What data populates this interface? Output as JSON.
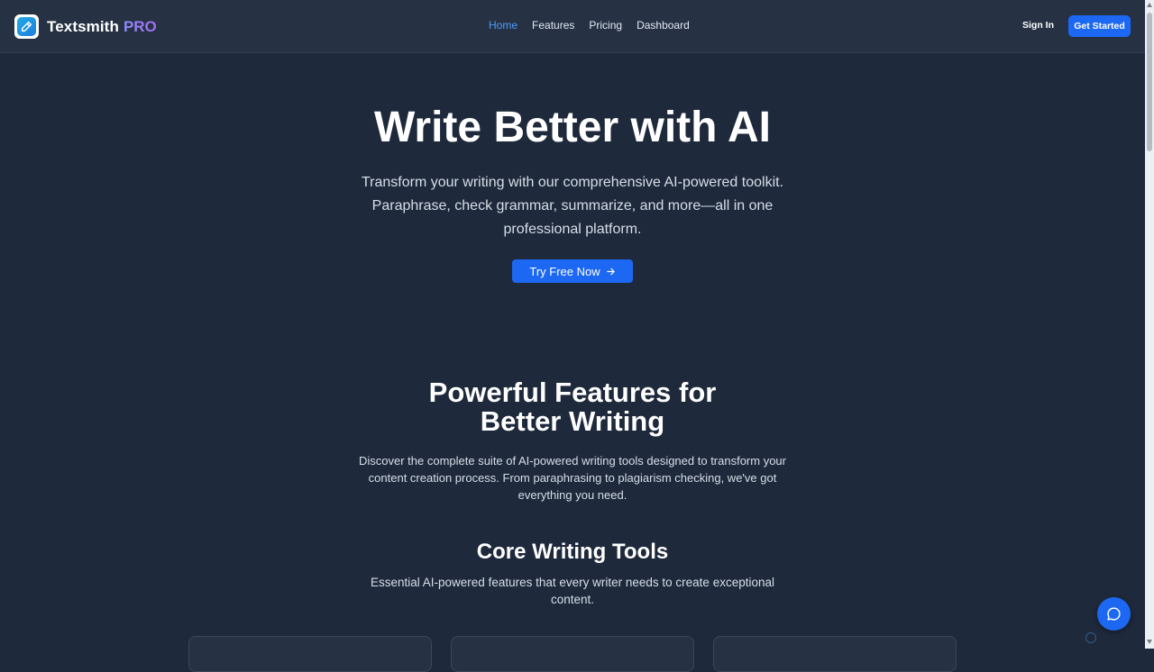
{
  "brand": {
    "name": "Textsmith",
    "tier": "PRO",
    "logo_icon": "pencil-icon"
  },
  "nav": {
    "links": [
      {
        "label": "Home",
        "active": true
      },
      {
        "label": "Features",
        "active": false
      },
      {
        "label": "Pricing",
        "active": false
      },
      {
        "label": "Dashboard",
        "active": false
      }
    ],
    "sign_in": "Sign In",
    "get_started": "Get Started"
  },
  "hero": {
    "title": "Write Better with AI",
    "subtitle_lines": [
      "Transform your writing with our comprehensive AI-powered toolkit.",
      "Paraphrase, check grammar, summarize, and more—all in one",
      "professional platform."
    ],
    "cta": "Try Free Now",
    "cta_icon": "arrow-right-icon"
  },
  "features": {
    "title_lines": [
      "Powerful Features for",
      "Better Writing"
    ],
    "description_lines": [
      "Discover the complete suite of AI-powered writing tools designed to transform your",
      "content creation process. From paraphrasing to plagiarism checking, we've got",
      "everything you need."
    ]
  },
  "core": {
    "title": "Core Writing Tools",
    "description_lines": [
      "Essential AI-powered features that every writer needs to create exceptional",
      "content."
    ]
  },
  "chat": {
    "icon": "chat-bubble-icon"
  },
  "colors": {
    "accent": "#1d68f2",
    "background": "#1e293b",
    "navbar": "#263244",
    "active_link": "#4f9bff"
  }
}
